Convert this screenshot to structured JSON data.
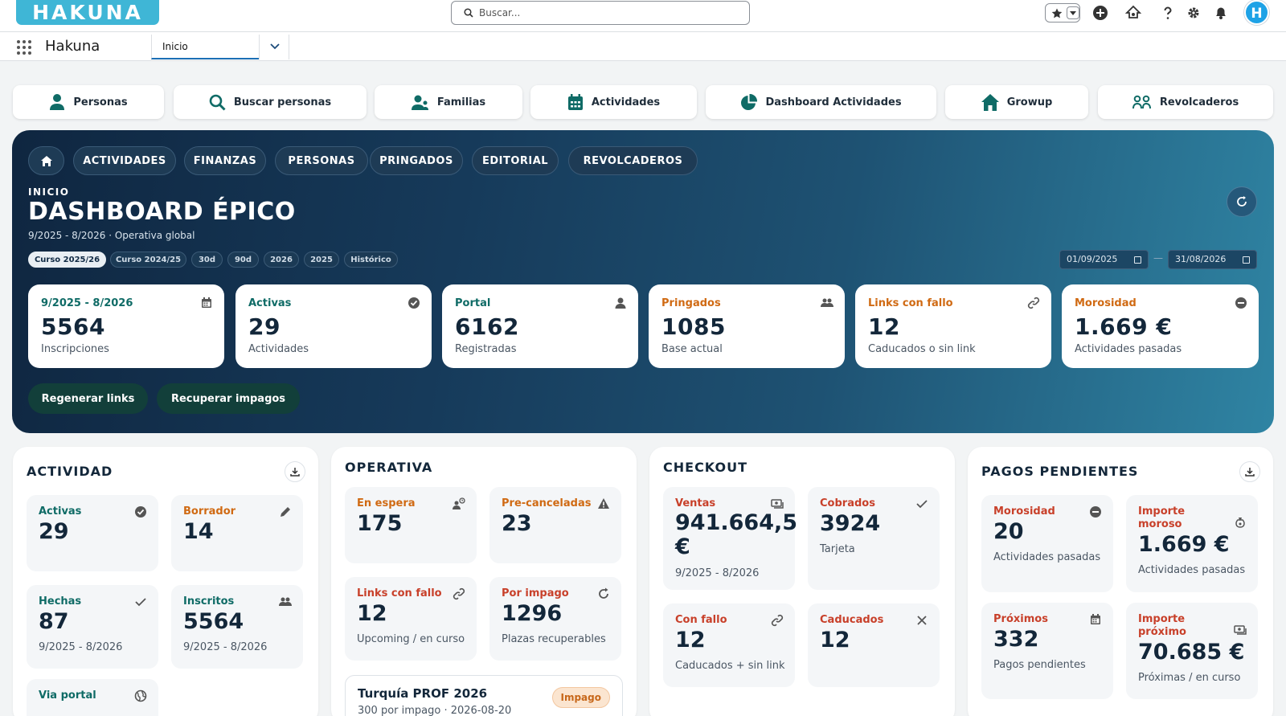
{
  "topbar": {
    "logo": "HAKUNA",
    "search_placeholder": "Buscar...",
    "avatar_letter": "H"
  },
  "navbar": {
    "app_name": "Hakuna",
    "tab": "Inicio"
  },
  "quicklinks": [
    {
      "label": "Personas",
      "icon": "person-icon"
    },
    {
      "label": "Buscar personas",
      "icon": "search-icon"
    },
    {
      "label": "Familias",
      "icon": "family-icon"
    },
    {
      "label": "Actividades",
      "icon": "calendar-icon"
    },
    {
      "label": "Dashboard Actividades",
      "icon": "pie-chart-icon"
    },
    {
      "label": "Growup",
      "icon": "home-icon"
    },
    {
      "label": "Revolcaderos",
      "icon": "group-icon"
    }
  ],
  "hero": {
    "pills": [
      "ACTIVIDADES",
      "FINANZAS",
      "PERSONAS",
      "PRINGADOS",
      "EDITORIAL",
      "REVOLCADEROS"
    ],
    "eyebrow": "INICIO",
    "title": "DASHBOARD ÉPICO",
    "subtitle": "9/2025 - 8/2026 · Operativa global",
    "chips": [
      "Curso 2025/26",
      "Curso 2024/25",
      "30d",
      "90d",
      "2026",
      "2025",
      "Histórico"
    ],
    "date_from": "01/09/2025",
    "date_sep": "—",
    "date_to": "31/08/2026",
    "kpis": [
      {
        "title": "9/2025 - 8/2026",
        "value": "5564",
        "sub": "Inscripciones",
        "color": "#0f6b66",
        "icon": "calendar-icon"
      },
      {
        "title": "Activas",
        "value": "29",
        "sub": "Actividades",
        "color": "#0f6b66",
        "icon": "check-circle-icon"
      },
      {
        "title": "Portal",
        "value": "6162",
        "sub": "Registradas",
        "color": "#0f6b66",
        "icon": "person-icon"
      },
      {
        "title": "Pringados",
        "value": "1085",
        "sub": "Base actual",
        "color": "#d06a13",
        "icon": "group-icon"
      },
      {
        "title": "Links con fallo",
        "value": "12",
        "sub": "Caducados o sin link",
        "color": "#d06a13",
        "icon": "link-icon"
      },
      {
        "title": "Morosidad",
        "value": "1.669 €",
        "sub": "Actividades pasadas",
        "color": "#d06a13",
        "icon": "minus-circle-icon"
      }
    ],
    "buttons": [
      "Regenerar links",
      "Recuperar impagos"
    ]
  },
  "actividad": {
    "title": "ACTIVIDAD",
    "cards": [
      {
        "title": "Activas",
        "value": "29",
        "sub": ""
      },
      {
        "title": "Borrador",
        "value": "14",
        "sub": ""
      },
      {
        "title": "Hechas",
        "value": "87",
        "sub": "9/2025 - 8/2026"
      },
      {
        "title": "Inscritos",
        "value": "5564",
        "sub": "9/2025 - 8/2026"
      },
      {
        "title": "Via portal",
        "value": "",
        "sub": ""
      }
    ]
  },
  "operativa": {
    "title": "OPERATIVA",
    "cards": [
      {
        "title": "En espera",
        "value": "175",
        "sub": ""
      },
      {
        "title": "Pre-canceladas",
        "value": "23",
        "sub": ""
      },
      {
        "title": "Links con fallo",
        "value": "12",
        "sub": "Upcoming / en curso"
      },
      {
        "title": "Por impago",
        "value": "1296",
        "sub": "Plazas recuperables"
      }
    ],
    "event": {
      "title": "Turquía PROF 2026",
      "sub": "300 por impago · 2026-08-20",
      "badge": "Impago"
    }
  },
  "checkout": {
    "title": "CHECKOUT",
    "cards": [
      {
        "title": "Ventas",
        "value": "941.664,5 €",
        "sub": "9/2025 - 8/2026"
      },
      {
        "title": "Cobrados",
        "value": "3924",
        "sub": "Tarjeta"
      },
      {
        "title": "Con fallo",
        "value": "12",
        "sub": "Caducados + sin link"
      },
      {
        "title": "Caducados",
        "value": "12",
        "sub": ""
      }
    ]
  },
  "pagos": {
    "title": "PAGOS PENDIENTES",
    "cards": [
      {
        "title": "Morosidad",
        "value": "20",
        "sub": "Actividades pasadas"
      },
      {
        "title": "Importe moroso",
        "value": "1.669 €",
        "sub": "Actividades pasadas"
      },
      {
        "title": "Próximos",
        "value": "332",
        "sub": "Pagos pendientes"
      },
      {
        "title": "Importe próximo",
        "value": "70.685 €",
        "sub": "Próximas / en curso"
      }
    ]
  }
}
